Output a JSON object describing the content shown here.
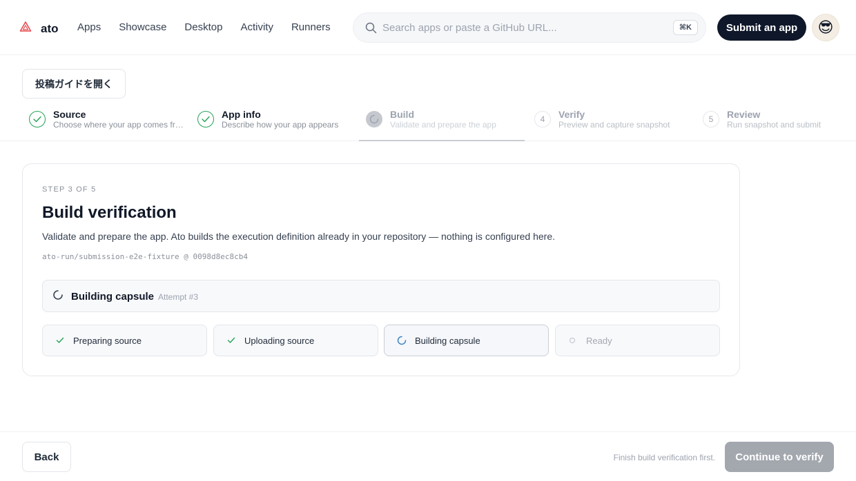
{
  "header": {
    "logo_icon": "triangle-logo-icon",
    "brand": "ato",
    "nav": [
      "Apps",
      "Showcase",
      "Desktop",
      "Activity",
      "Runners"
    ],
    "search": {
      "placeholder": "Search apps or paste a GitHub URL...",
      "value": "",
      "shortcut": "⌘K"
    },
    "submit_label": "Submit an app",
    "avatar": "😎"
  },
  "guide_button": "投稿ガイドを開く",
  "stepper": [
    {
      "number": "1",
      "title": "Source",
      "desc": "Choose where your app comes from",
      "state": "done"
    },
    {
      "number": "2",
      "title": "App info",
      "desc": "Describe how your app appears",
      "state": "done"
    },
    {
      "number": "3",
      "title": "Build",
      "desc": "Validate and prepare the app",
      "state": "active"
    },
    {
      "number": "4",
      "title": "Verify",
      "desc": "Preview and capture snapshot",
      "state": "todo"
    },
    {
      "number": "5",
      "title": "Review",
      "desc": "Run snapshot and submit",
      "state": "todo"
    }
  ],
  "card": {
    "step_label": "STEP 3 OF 5",
    "title": "Build verification",
    "description": "Validate and prepare the app. Ato builds the execution definition already in your repository — nothing is configured here.",
    "repo": "ato-run/submission-e2e-fixture @ 0098d8ec8cb4",
    "status": {
      "title": "Building capsule",
      "attempt": "Attempt #3"
    },
    "phases": [
      {
        "label": "Preparing source",
        "state": "done"
      },
      {
        "label": "Uploading source",
        "state": "done"
      },
      {
        "label": "Building capsule",
        "state": "current"
      },
      {
        "label": "Ready",
        "state": "pending"
      }
    ]
  },
  "footer": {
    "back_label": "Back",
    "note": "Finish build verification first.",
    "continue_label": "Continue to verify"
  },
  "colors": {
    "accent_dark": "#0f172a",
    "success": "#22a355",
    "logo": "#e5484d",
    "disabled_button": "#a3a7ae"
  }
}
